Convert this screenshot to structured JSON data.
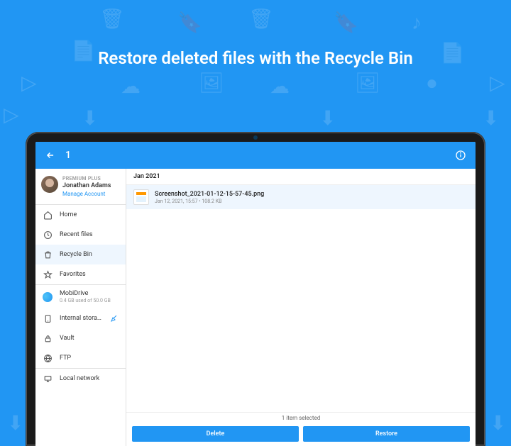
{
  "hero": {
    "title": "Restore deleted files with the Recycle Bin"
  },
  "appbar": {
    "back_count": "1"
  },
  "profile": {
    "plan": "PREMIUM PLUS",
    "name": "Jonathan Adams",
    "manage": "Manage Account"
  },
  "nav": {
    "home": "Home",
    "recent": "Recent files",
    "recycle": "Recycle Bin",
    "favorites": "Favorites",
    "mobidrive": "MobiDrive",
    "mobidrive_sub": "0.4 GB used of 50.0 GB",
    "internal": "Internal stora…",
    "vault": "Vault",
    "ftp": "FTP",
    "local": "Local network"
  },
  "main": {
    "section": "Jan 2021",
    "file": {
      "name": "Screenshot_2021-01-12-15-57-45.png",
      "meta": "Jan 12, 2021, 15:57  •  108.2 KB"
    }
  },
  "footer": {
    "selected": "1 item selected",
    "delete": "Delete",
    "restore": "Restore"
  }
}
